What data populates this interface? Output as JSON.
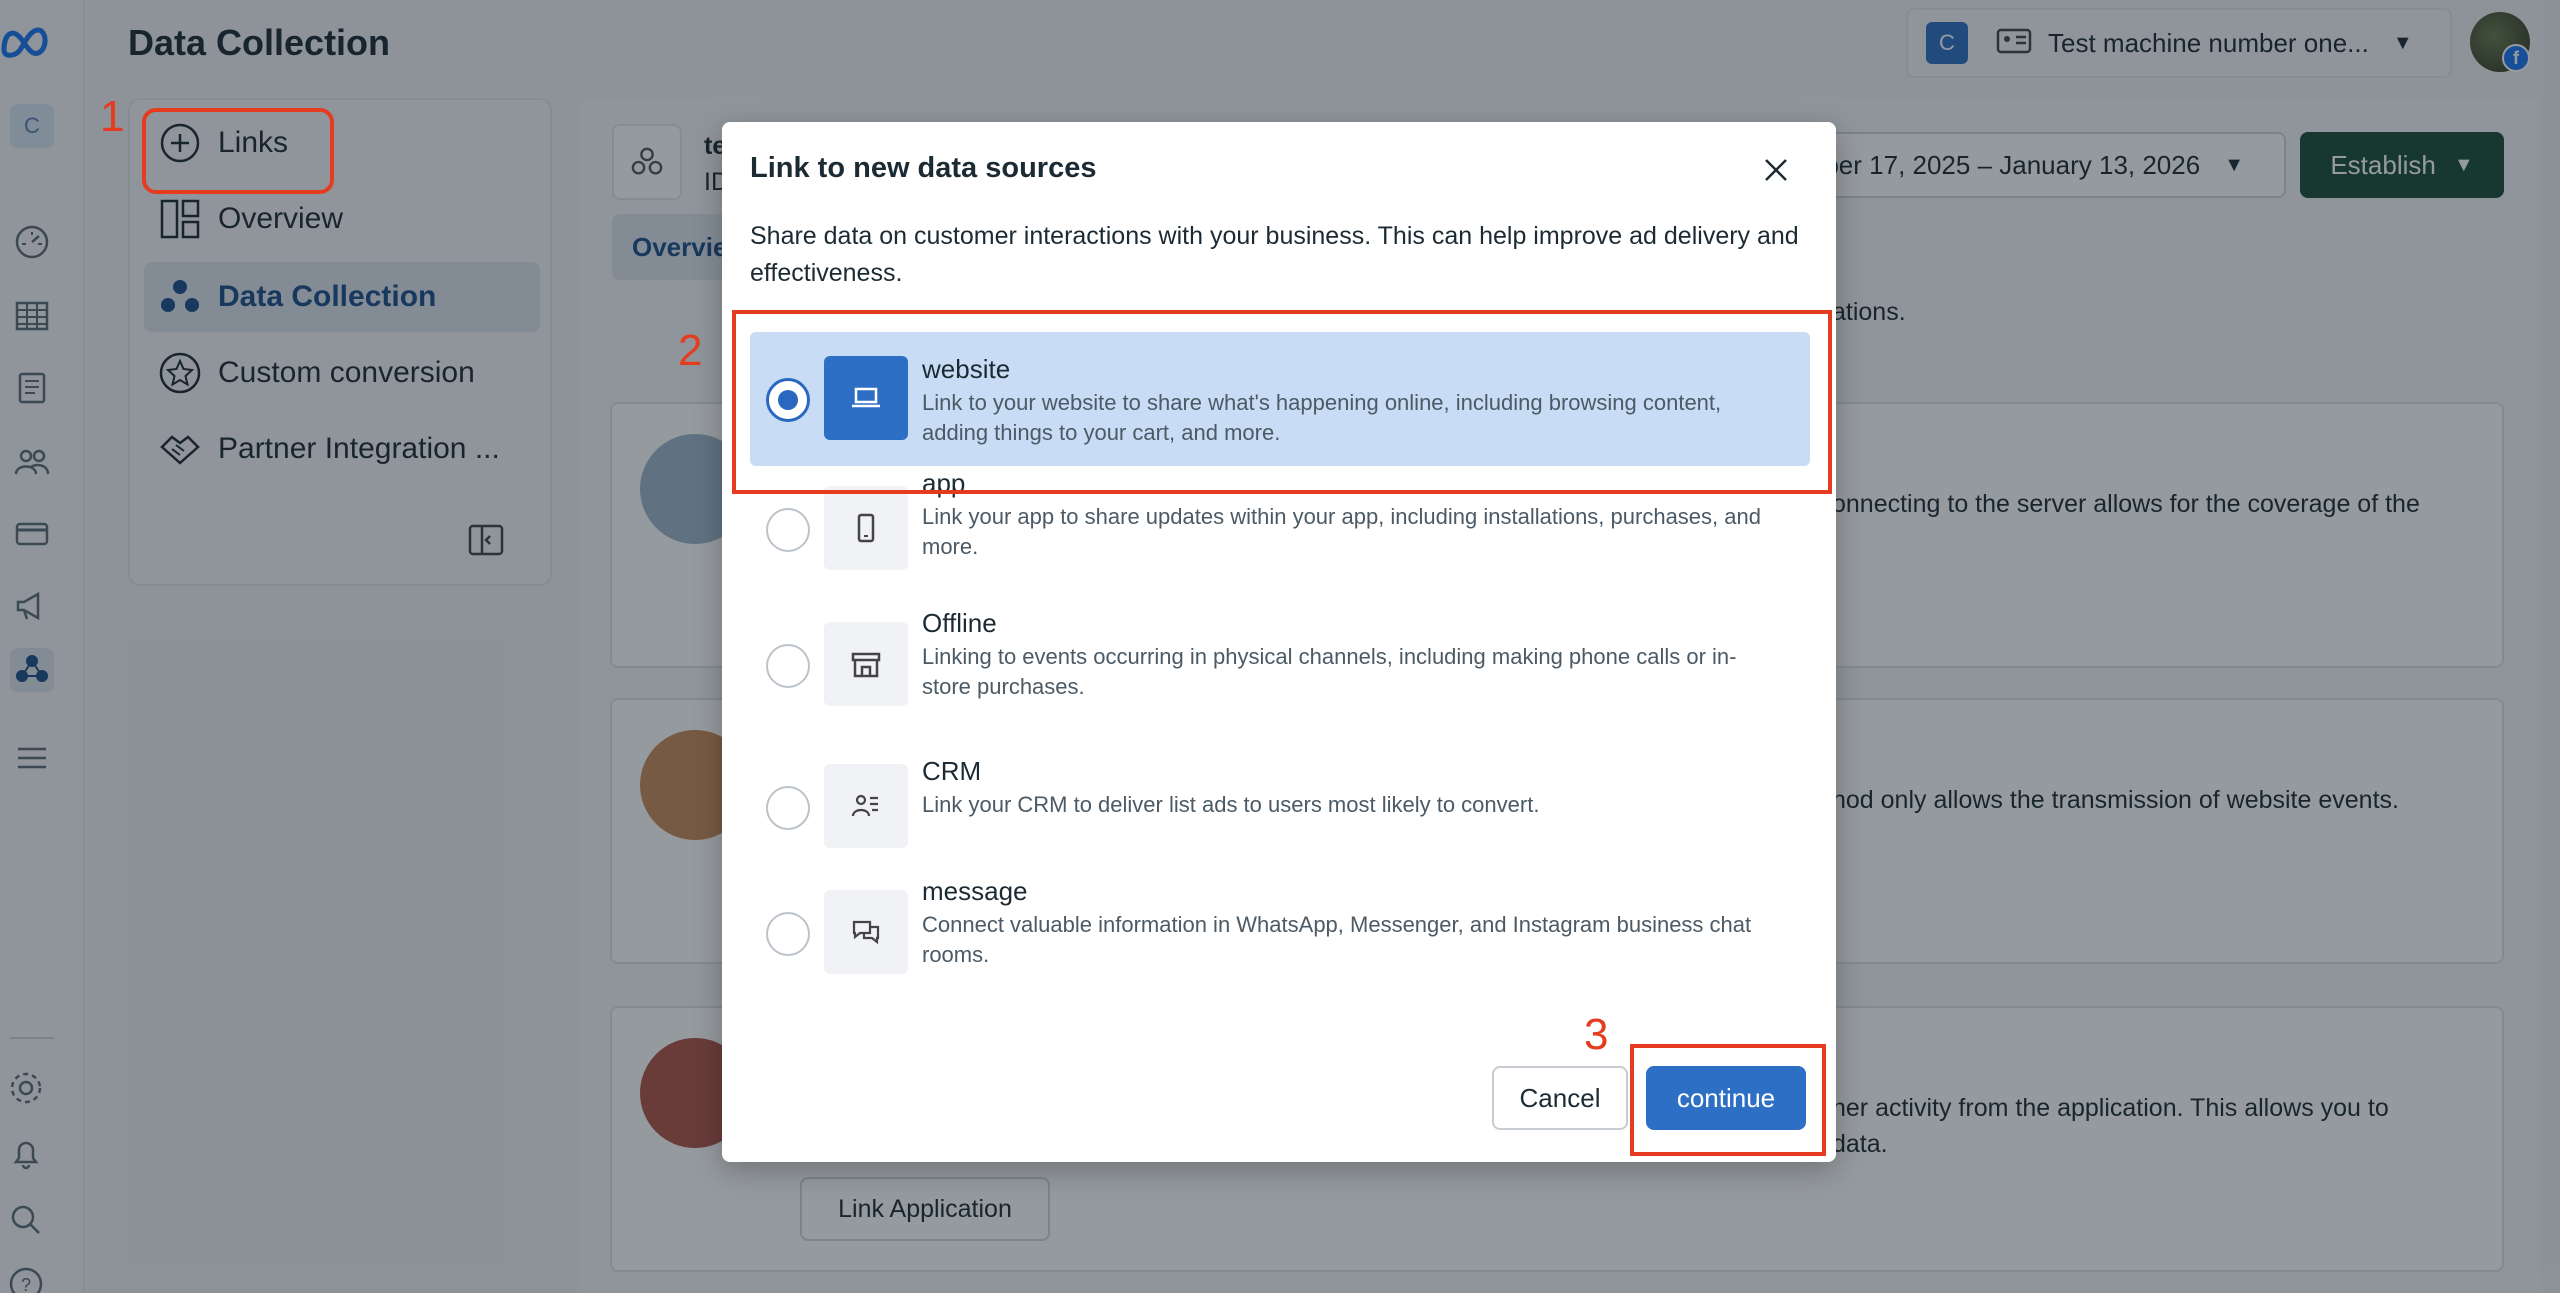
{
  "app": {
    "logo": "meta-logo",
    "page_title": "Data Collection"
  },
  "rail": {
    "account_initial": "C",
    "icons": [
      "dashboard-icon",
      "table-icon",
      "document-icon",
      "audience-icon",
      "billing-icon",
      "megaphone-icon",
      "data-collection-icon",
      "menu-icon",
      "settings-icon",
      "bell-icon",
      "search-icon",
      "help-icon"
    ]
  },
  "header": {
    "account_badge": "C",
    "account_name": "Test machine number one...",
    "caret": "▼"
  },
  "subnav": {
    "links_label": "Links",
    "items": [
      {
        "label": "Overview",
        "icon": "layout-icon"
      },
      {
        "label": "Data Collection",
        "icon": "data-collection-icon"
      },
      {
        "label": "Custom conversion",
        "icon": "star-icon"
      },
      {
        "label": "Partner Integration ...",
        "icon": "handshake-icon"
      }
    ]
  },
  "main": {
    "tab_label": "Overvie",
    "date_range": "mber 17, 2025 – January 13, 2026",
    "establish_label": "Establish",
    "snippets": {
      "intro": "ations.",
      "card1": "onnecting to the server allows for the coverage of the",
      "card2": "hod only allows the transmission of website events.",
      "card3_line1": "ner activity from the application. This allows you to",
      "card3_line2": "data."
    },
    "link_application_label": "Link Application",
    "id_label": "ID",
    "name_fragment": "te"
  },
  "dialog": {
    "title": "Link to new data sources",
    "description": "Share data on customer interactions with your business. This can help improve ad delivery and effectiveness.",
    "options": [
      {
        "title": "website",
        "desc": "Link to your website to share what's happening online, including browsing content, adding things to your cart, and more.",
        "icon": "laptop-icon",
        "selected": true
      },
      {
        "title": "app",
        "desc": "Link your app to share updates within your app, including installations, purchases, and more.",
        "icon": "phone-icon",
        "selected": false
      },
      {
        "title": "Offline",
        "desc": "Linking to events occurring in physical channels, including making phone calls or in-store purchases.",
        "icon": "store-icon",
        "selected": false
      },
      {
        "title": "CRM",
        "desc": "Link your CRM to deliver list ads to users most likely to convert.",
        "icon": "crm-icon",
        "selected": false
      },
      {
        "title": "message",
        "desc": "Connect valuable information in WhatsApp, Messenger, and Instagram business chat rooms.",
        "icon": "chat-icon",
        "selected": false
      }
    ],
    "cancel_label": "Cancel",
    "continue_label": "continue"
  },
  "annotations": {
    "step1": "1",
    "step2": "2",
    "step3": "3"
  },
  "colors": {
    "accent": "#2d6fc4",
    "annotation_red": "#e53c1f",
    "establish_green": "#1a4d3a"
  }
}
